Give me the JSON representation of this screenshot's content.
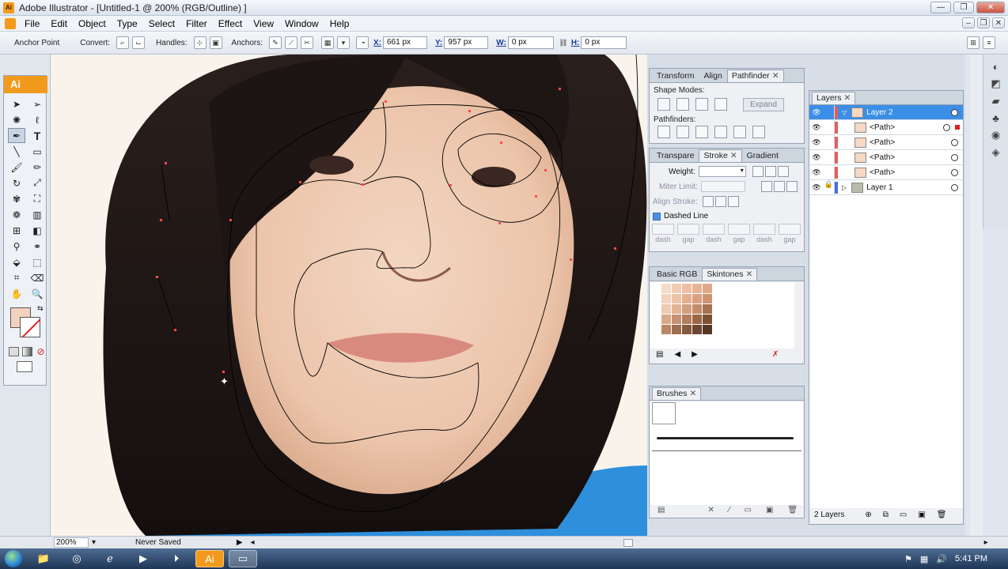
{
  "window": {
    "title": "Adobe Illustrator - [Untitled-1 @ 200% (RGB/Outline) ]",
    "app_icon": "Ai"
  },
  "menu": [
    "File",
    "Edit",
    "Object",
    "Type",
    "Select",
    "Filter",
    "Effect",
    "View",
    "Window",
    "Help"
  ],
  "control": {
    "mode_label": "Anchor Point",
    "convert_label": "Convert:",
    "handles_label": "Handles:",
    "anchors_label": "Anchors:",
    "x_label": "X:",
    "x_value": "661 px",
    "y_label": "Y:",
    "y_value": "957 px",
    "w_label": "W:",
    "w_value": "0 px",
    "h_label": "H:",
    "h_value": "0 px"
  },
  "toolbox": {
    "logo": "Ai",
    "fill_color": "#f3d2bd"
  },
  "pathfinder_panel": {
    "tabs": [
      "Transform",
      "Align",
      "Pathfinder"
    ],
    "active_tab": "Pathfinder",
    "shape_modes_label": "Shape Modes:",
    "expand_label": "Expand",
    "pathfinders_label": "Pathfinders:"
  },
  "stroke_panel": {
    "tabs": [
      "Transpare",
      "Stroke",
      "Gradient"
    ],
    "active_tab": "Stroke",
    "weight_label": "Weight:",
    "miter_label": "Miter Limit:",
    "align_label": "Align Stroke:",
    "dashed_label": "Dashed Line",
    "dash_labels": [
      "dash",
      "gap",
      "dash",
      "gap",
      "dash",
      "gap"
    ]
  },
  "swatch_panel": {
    "tabs": [
      "Basic RGB",
      "Skintones"
    ],
    "active_tab": "Skintones",
    "colors": [
      "#f6dcc8",
      "#f1cdb4",
      "#eebfa4",
      "#e8b394",
      "#e0a889",
      "#f3d3bd",
      "#ecc3a6",
      "#e3b08f",
      "#d9a07f",
      "#cf9372",
      "#eecab0",
      "#e2b391",
      "#d39e7c",
      "#c58c69",
      "#a8714f",
      "#d9a888",
      "#c79274",
      "#b27e5e",
      "#9a6848",
      "#7a5036",
      "#b98766",
      "#9d6e4f",
      "#845a3e",
      "#6d4630",
      "#573624"
    ]
  },
  "brushes_panel": {
    "tabs": [
      "Brushes"
    ]
  },
  "layers_panel": {
    "tabs": [
      "Layers"
    ],
    "rows": [
      {
        "name": "Layer 2",
        "selected": true,
        "indent": 0
      },
      {
        "name": "<Path>",
        "selected": false,
        "indent": 1
      },
      {
        "name": "<Path>",
        "selected": false,
        "indent": 1
      },
      {
        "name": "<Path>",
        "selected": false,
        "indent": 1
      },
      {
        "name": "<Path>",
        "selected": false,
        "indent": 1
      },
      {
        "name": "Layer 1",
        "selected": false,
        "indent": 0
      }
    ],
    "footer": "2 Layers"
  },
  "status": {
    "zoom": "200%",
    "save_state": "Never Saved"
  },
  "taskbar": {
    "time": "5:41 PM"
  }
}
